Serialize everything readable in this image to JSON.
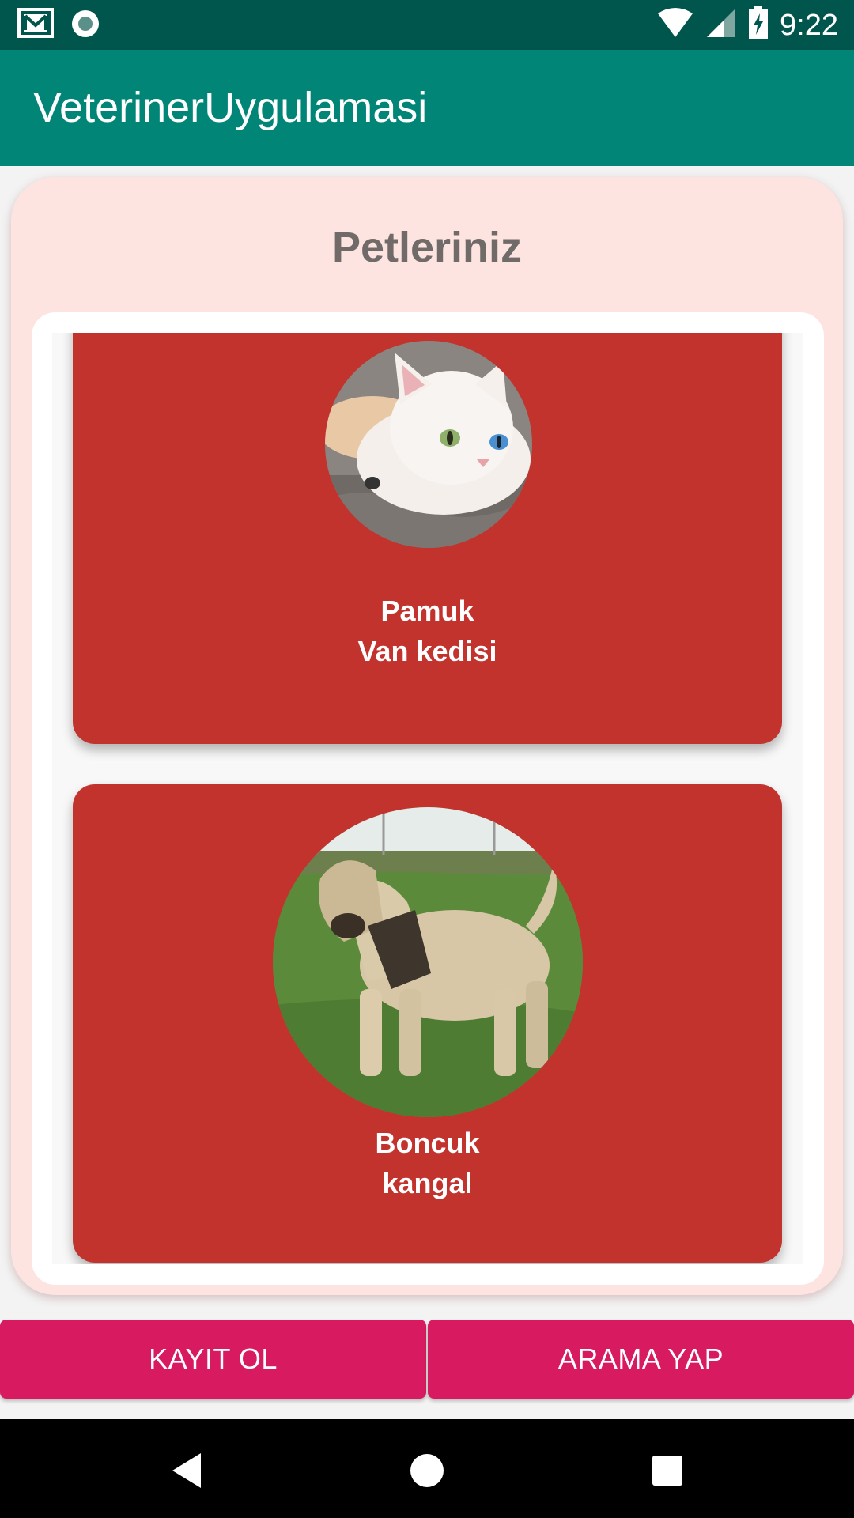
{
  "status_bar": {
    "time": "9:22",
    "left_icons": [
      "gmail-icon",
      "notification-dot-icon"
    ],
    "right_icons": [
      "wifi-icon",
      "signal-icon",
      "battery-charging-icon"
    ]
  },
  "app_bar": {
    "title": "VeterinerUygulamasi"
  },
  "pets_section": {
    "title": "Petleriniz",
    "pets": [
      {
        "name": "Pamuk",
        "breed": "Van kedisi",
        "photo": "white-cat-photo"
      },
      {
        "name": "Boncuk",
        "breed": "kangal",
        "photo": "kangal-dog-photo"
      }
    ]
  },
  "actions": {
    "register_label": "KAYIT OL",
    "search_label": "ARAMA YAP"
  },
  "nav_bar": {
    "icons": [
      "back-icon",
      "home-icon",
      "recents-icon"
    ]
  },
  "colors": {
    "status_bar": "#00564d",
    "app_bar": "#008577",
    "card_background": "#fee4e1",
    "pet_card": "#c3332e",
    "button": "#d81b60",
    "title_text": "#706a69"
  }
}
